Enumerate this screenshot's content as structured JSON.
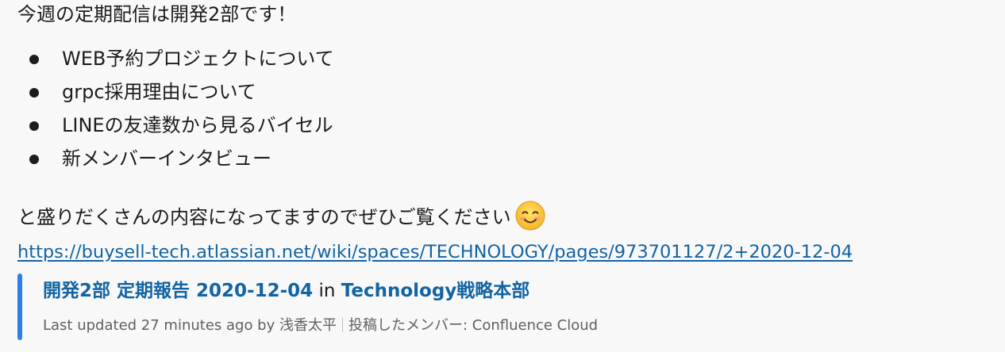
{
  "message": {
    "intro": "今週の定期配信は開発2部です！",
    "bullets": [
      "WEB予約プロジェクトについて",
      "grpc採用理由について",
      "LINEの友達数から見るバイセル",
      "新メンバーインタビュー"
    ],
    "closing": "と盛りだくさんの内容になってますのでぜひご覧ください",
    "emoji": "smiling-face-icon",
    "link": "https://buysell-tech.atlassian.net/wiki/spaces/TECHNOLOGY/pages/973701127/2+2020-12-04"
  },
  "unfurl": {
    "page_title": "開発2部 定期報告 2020-12-04",
    "in_text": "in",
    "space_name": "Technology戦略本部",
    "updated": "Last updated 27 minutes ago by 浅香太平",
    "poster": "投稿したメンバー: Confluence Cloud",
    "accent_color": "#2d7fea"
  },
  "colors": {
    "link": "#1264a3",
    "text": "#1d1c1d",
    "meta": "#616061",
    "background": "#f8f8f8"
  }
}
